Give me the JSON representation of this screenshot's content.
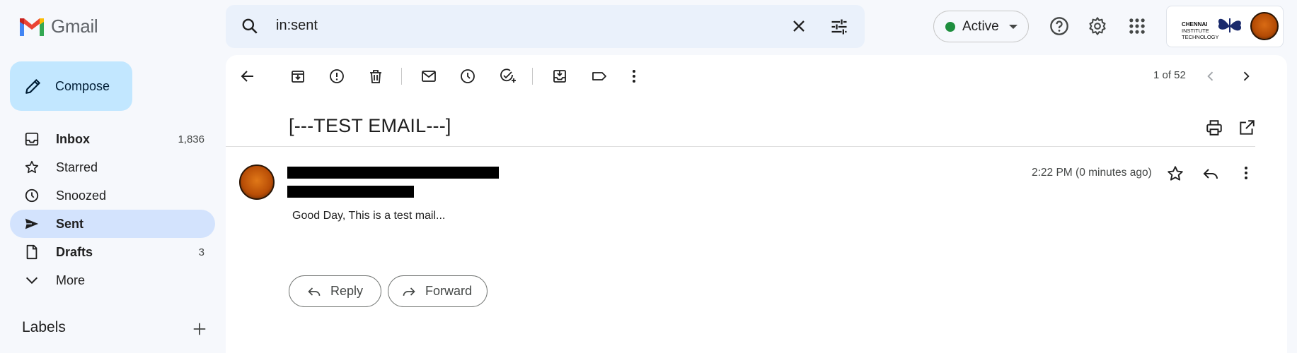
{
  "app": {
    "name": "Gmail"
  },
  "search": {
    "query": "in:sent"
  },
  "status": {
    "label": "Active",
    "color": "#1e8e3e"
  },
  "account": {
    "org_line1": "CHENNAI",
    "org_line2": "INSTITUTE",
    "org_line3": "TECHNOLOGY"
  },
  "compose": {
    "label": "Compose"
  },
  "nav": {
    "items": [
      {
        "label": "Inbox",
        "count": "1,836",
        "icon": "inbox-icon"
      },
      {
        "label": "Starred",
        "count": "",
        "icon": "star-icon"
      },
      {
        "label": "Snoozed",
        "count": "",
        "icon": "clock-icon"
      },
      {
        "label": "Sent",
        "count": "",
        "icon": "send-icon"
      },
      {
        "label": "Drafts",
        "count": "3",
        "icon": "draft-icon"
      },
      {
        "label": "More",
        "count": "",
        "icon": "chevron-down-icon"
      }
    ],
    "labels_header": "Labels"
  },
  "toolbar": {
    "pager": "1 of 52"
  },
  "message": {
    "subject": "[---TEST EMAIL---]",
    "time": "2:22 PM (0 minutes ago)",
    "body": "Good Day, This is a test mail..."
  },
  "actions": {
    "reply": "Reply",
    "forward": "Forward"
  },
  "colors": {
    "accent": "#0b57d0",
    "selected_nav": "#d3e3fd",
    "compose_bg": "#c2e7ff"
  }
}
